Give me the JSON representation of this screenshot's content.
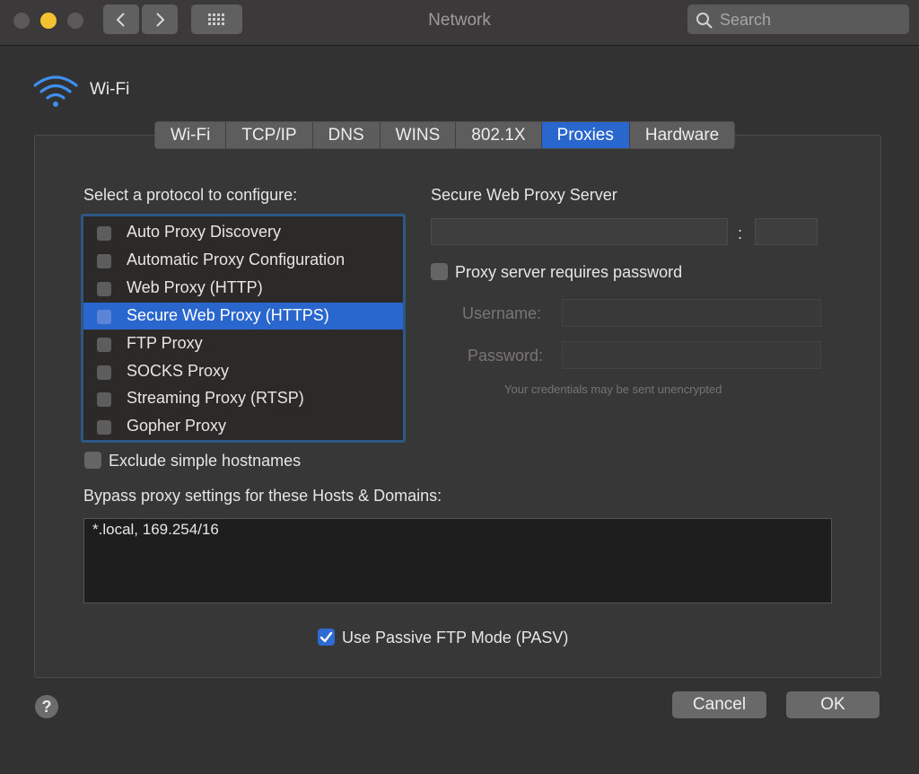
{
  "window": {
    "title": "Network"
  },
  "search": {
    "placeholder": "Search"
  },
  "interface": {
    "name": "Wi-Fi"
  },
  "tabs": [
    {
      "label": "Wi-Fi"
    },
    {
      "label": "TCP/IP"
    },
    {
      "label": "DNS"
    },
    {
      "label": "WINS"
    },
    {
      "label": "802.1X"
    },
    {
      "label": "Proxies",
      "active": true
    },
    {
      "label": "Hardware"
    }
  ],
  "protocols": {
    "heading": "Select a protocol to configure:",
    "items": [
      {
        "label": "Auto Proxy Discovery",
        "checked": false
      },
      {
        "label": "Automatic Proxy Configuration",
        "checked": false
      },
      {
        "label": "Web Proxy (HTTP)",
        "checked": false
      },
      {
        "label": "Secure Web Proxy (HTTPS)",
        "checked": false,
        "selected": true
      },
      {
        "label": "FTP Proxy",
        "checked": false
      },
      {
        "label": "SOCKS Proxy",
        "checked": false
      },
      {
        "label": "Streaming Proxy (RTSP)",
        "checked": false
      },
      {
        "label": "Gopher Proxy",
        "checked": false
      }
    ]
  },
  "server": {
    "heading": "Secure Web Proxy Server",
    "host_value": "",
    "separator": ":",
    "port_value": "",
    "requires_password_label": "Proxy server requires password",
    "requires_password": false,
    "username_label": "Username:",
    "password_label": "Password:",
    "credentials_note": "Your credentials may be sent unencrypted"
  },
  "exclude_simple": {
    "label": "Exclude simple hostnames",
    "checked": false
  },
  "bypass": {
    "heading": "Bypass proxy settings for these Hosts & Domains:",
    "value": "*.local, 169.254/16"
  },
  "passive_ftp": {
    "label": "Use Passive FTP Mode (PASV)",
    "checked": true
  },
  "footer": {
    "help_label": "?",
    "cancel_label": "Cancel",
    "ok_label": "OK"
  },
  "colors": {
    "accent": "#2967cf",
    "selection": "#2967cf",
    "focus_ring": "#2d5784"
  }
}
